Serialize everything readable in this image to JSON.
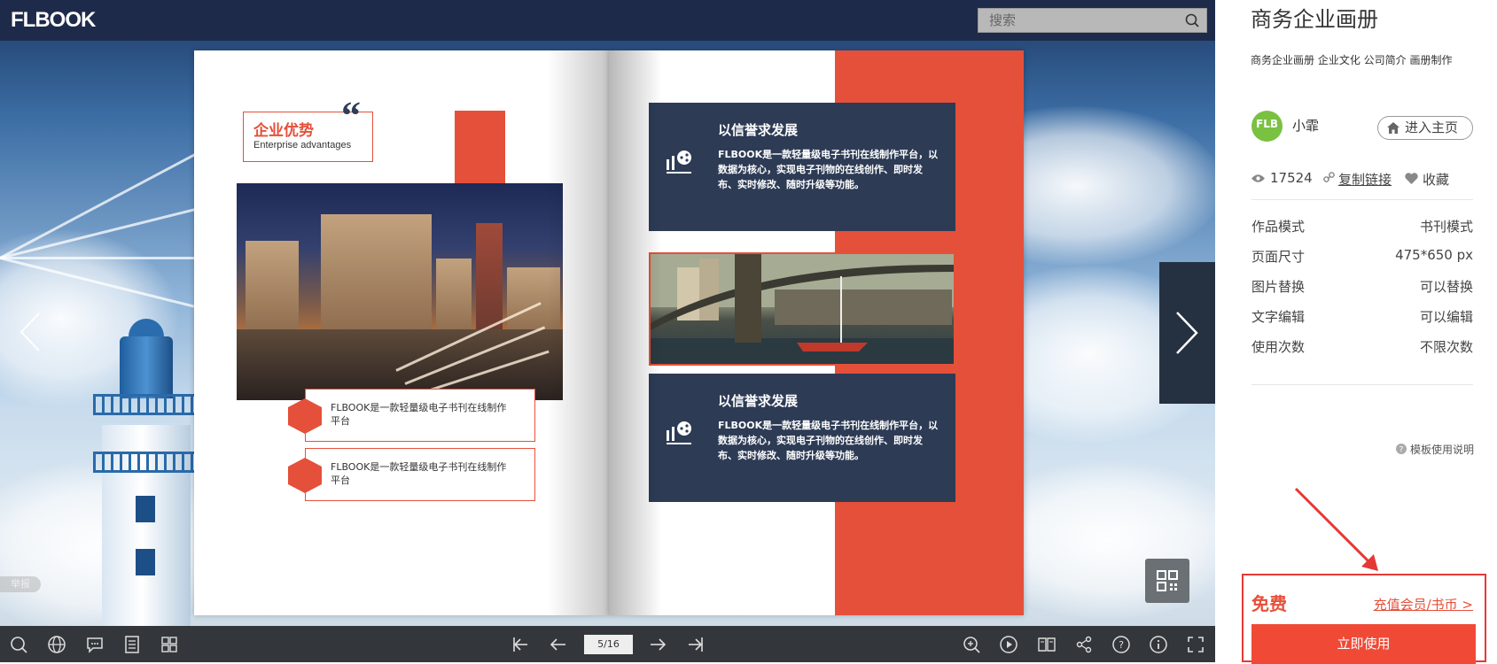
{
  "topbar": {
    "logo": "FLBOOK",
    "search_placeholder": "搜索"
  },
  "viewer": {
    "report_label": "举报"
  },
  "book": {
    "left_page": {
      "section_title": "企业优势",
      "section_subtitle": "Enterprise advantages",
      "quote_mark": "“",
      "features": [
        "FLBOOK是一款轻量级电子书刊在线制作平台",
        "FLBOOK是一款轻量级电子书刊在线制作平台"
      ]
    },
    "right_page": {
      "cards": [
        {
          "title": "以信誉求发展",
          "text": "FLBOOK是一款轻量级电子书刊在线制作平台，以数据为核心，实现电子刊物的在线创作、即时发布、实时修改、随时升级等功能。"
        },
        {
          "title": "以信誉求发展",
          "text": "FLBOOK是一款轻量级电子书刊在线制作平台，以数据为核心，实现电子刊物的在线创作、即时发布、实时修改、随时升级等功能。"
        }
      ]
    }
  },
  "toolbar": {
    "page_indicator": "5/16"
  },
  "panel": {
    "title": "商务企业画册",
    "tags": "商务企业画册 企业文化 公司简介 画册制作",
    "author": {
      "avatar_text": "FLB",
      "name": "小霏"
    },
    "home_button": "进入主页",
    "views": "17524",
    "copy_link": "复制链接",
    "favorite": "收藏",
    "info": [
      {
        "key": "作品模式",
        "value": "书刊模式"
      },
      {
        "key": "页面尺寸",
        "value": "475*650 px"
      },
      {
        "key": "图片替换",
        "value": "可以替换"
      },
      {
        "key": "文字编辑",
        "value": "可以编辑"
      },
      {
        "key": "使用次数",
        "value": "不限次数"
      }
    ],
    "help": "模板使用说明",
    "free_label": "免费",
    "recharge_link": "充值会员/书币 >",
    "use_button": "立即使用"
  },
  "colors": {
    "accent_red": "#e5503a",
    "navy": "#2d3b55",
    "toolbar": "#33373b",
    "topbar": "#1e2a4a"
  }
}
